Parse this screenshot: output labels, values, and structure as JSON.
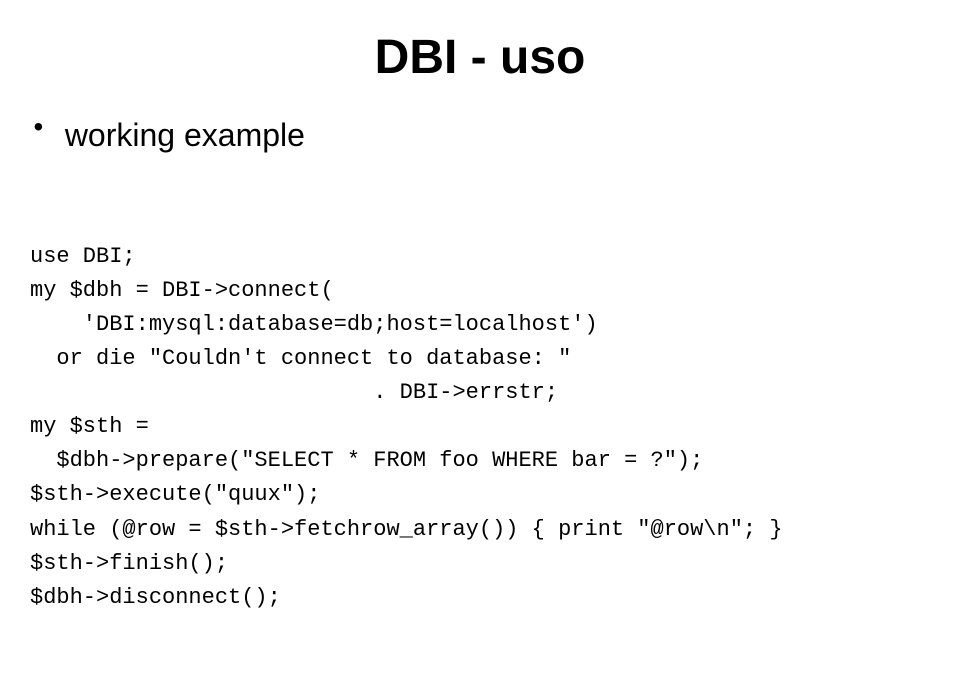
{
  "title": "DBI - uso",
  "bullet": {
    "dot": "•",
    "label": "working example"
  },
  "code": {
    "lines": [
      "use DBI;",
      "my $dbh = DBI->connect(",
      "    'DBI:mysql:database=db;host=localhost')",
      "  or die \"Couldn't connect to database: \"",
      "                          . DBI->errstr;",
      "my $sth =",
      "  $dbh->prepare(\"SELECT * FROM foo WHERE bar = ?\");",
      "$sth->execute(\"quux\");",
      "while (@row = $sth->fetchrow_array()) { print \"@row\\n\"; }",
      "$sth->finish();",
      "$dbh->disconnect();"
    ]
  }
}
